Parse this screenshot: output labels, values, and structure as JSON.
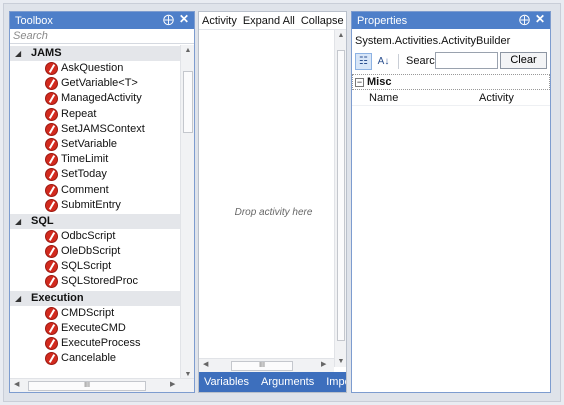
{
  "toolbox": {
    "title": "Toolbox",
    "pin_glyph": "⨁",
    "close_glyph": "✕",
    "search_placeholder": "Search",
    "categories": [
      {
        "name": "JAMS",
        "items": [
          "AskQuestion",
          "GetVariable<T>",
          "ManagedActivity",
          "Repeat",
          "SetJAMSContext",
          "SetVariable",
          "TimeLimit",
          "SetToday",
          "Comment",
          "SubmitEntry"
        ]
      },
      {
        "name": "SQL",
        "items": [
          "OdbcScript",
          "OleDbScript",
          "SQLScript",
          "SQLStoredProc"
        ]
      },
      {
        "name": "Execution",
        "items": [
          "CMDScript",
          "ExecuteCMD",
          "ExecuteProcess",
          "Cancelable"
        ]
      }
    ],
    "item_icon": "activity-icon"
  },
  "designer": {
    "toolbar": {
      "activity_label": "Activity",
      "expand_all": "Expand All",
      "collapse_all": "Collapse All"
    },
    "drop_hint": "Drop activity here",
    "tabs": [
      "Variables",
      "Arguments",
      "Imports"
    ]
  },
  "properties": {
    "title": "Properties",
    "pin_glyph": "⨁",
    "close_glyph": "✕",
    "object_type": "System.Activities.ActivityBuilder",
    "search_label": "Search:",
    "search_value": "",
    "clear_label": "Clear",
    "categorized_icon": "categorized-view-icon",
    "alphabetical_icon": "alphabetical-sort-icon",
    "category": {
      "name": "Misc",
      "expander": "−",
      "rows": [
        {
          "name": "Name",
          "value": "Activity"
        }
      ]
    }
  },
  "colors": {
    "title_bar": "#4e7fc9",
    "tab_bar": "#3d6fbd",
    "icon_red": "#d22a1e"
  }
}
